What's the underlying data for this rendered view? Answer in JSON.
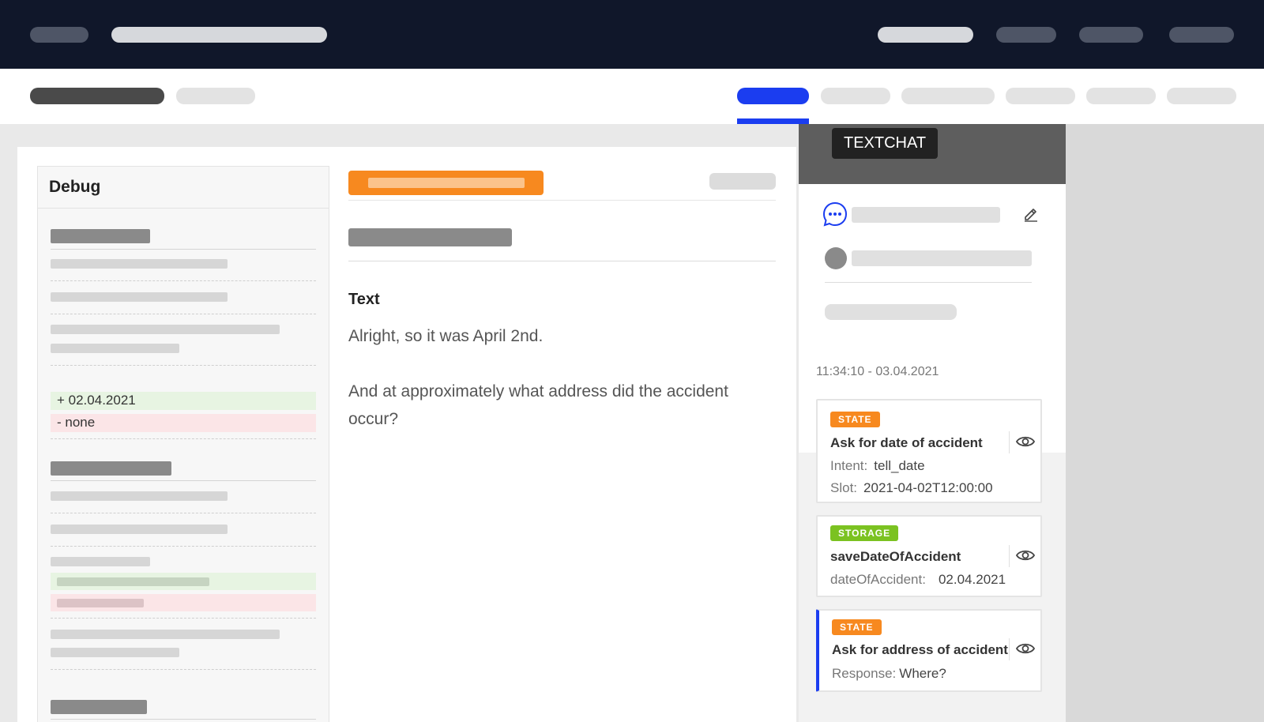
{
  "side": {
    "header_label": "TEXTCHAT",
    "timestamp": "11:34:10 - 03.04.2021",
    "cards": [
      {
        "badge": "STATE",
        "title": "Ask for date of accident",
        "rows": [
          {
            "key": "Intent:",
            "value": "tell_date"
          },
          {
            "key": "Slot:",
            "value": "2021-04-02T12:00:00"
          }
        ]
      },
      {
        "badge": "STORAGE",
        "title": "saveDateOfAccident",
        "rows": [
          {
            "key": "dateOfAccident:",
            "value": "02.04.2021"
          }
        ]
      },
      {
        "badge": "STATE",
        "title": "Ask for address of accident",
        "rows": [
          {
            "key": "Response:",
            "value": "Where?"
          }
        ]
      }
    ]
  },
  "debug": {
    "title": "Debug",
    "diff_added": "+ 02.04.2021",
    "diff_removed": "- none"
  },
  "message": {
    "label": "Text",
    "line1": "Alright, so it was April 2nd.",
    "line2": "And at approximately what address did the accident occur?"
  },
  "colors": {
    "topbar": "#10172a",
    "accent": "#1b3df0",
    "state_badge": "#f7891f",
    "storage_badge": "#7bc221",
    "diff_added_bg": "#e7f4e2",
    "diff_removed_bg": "#fbe5e7"
  },
  "icons": {
    "chat": "chat-bubble-icon",
    "edit": "pencil-icon",
    "eye": "eye-icon"
  }
}
